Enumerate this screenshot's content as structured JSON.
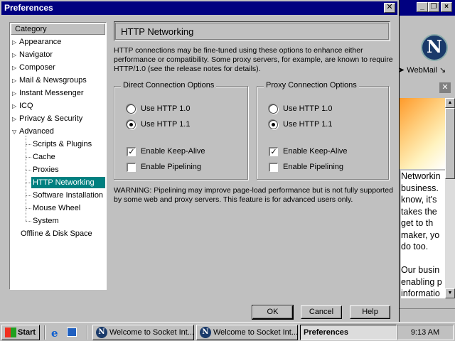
{
  "dialog": {
    "title": "Preferences",
    "close_glyph": "✕"
  },
  "tree": {
    "header": "Category",
    "items": [
      {
        "label": "Appearance",
        "expand": "▷"
      },
      {
        "label": "Navigator",
        "expand": "▷"
      },
      {
        "label": "Composer",
        "expand": "▷"
      },
      {
        "label": "Mail & Newsgroups",
        "expand": "▷"
      },
      {
        "label": "Instant Messenger",
        "expand": "▷"
      },
      {
        "label": "ICQ",
        "expand": "▷"
      },
      {
        "label": "Privacy & Security",
        "expand": "▷"
      },
      {
        "label": "Advanced",
        "expand": "▽"
      },
      {
        "label": "Scripts & Plugins"
      },
      {
        "label": "Cache"
      },
      {
        "label": "Proxies"
      },
      {
        "label": "HTTP Networking"
      },
      {
        "label": "Software Installation"
      },
      {
        "label": "Mouse Wheel"
      },
      {
        "label": "System"
      },
      {
        "label": "Offline & Disk Space"
      }
    ]
  },
  "panel": {
    "title": "HTTP Networking",
    "description": "HTTP connections may be fine-tuned using these options to enhance either performance or compatibility. Some proxy servers, for example, are known to require HTTP/1.0 (see the release notes for details).",
    "direct": {
      "label": "Direct Connection Options",
      "http10": "Use HTTP 1.0",
      "http11": "Use HTTP 1.1",
      "keepalive": "Enable Keep-Alive",
      "pipelining": "Enable Pipelining"
    },
    "proxy": {
      "label": "Proxy Connection Options",
      "http10": "Use HTTP 1.0",
      "http11": "Use HTTP 1.1",
      "keepalive": "Enable Keep-Alive",
      "pipelining": "Enable Pipelining"
    },
    "warning": "WARNING: Pipelining may improve page-load performance but is not fully supported by some web and proxy servers. This feature is for advanced users only."
  },
  "buttons": {
    "ok": "OK",
    "cancel": "Cancel",
    "help": "Help"
  },
  "background_window": {
    "webmail": "WebMail",
    "logo": "N",
    "text_lines": [
      "Networkin",
      "business.",
      "know, it's",
      "takes the",
      "get to th",
      "maker, yo",
      "do too.",
      "",
      "Our busin",
      "enabling p",
      "informatio"
    ]
  },
  "taskbar": {
    "start": "Start",
    "tasks": [
      "Welcome to Socket Int...",
      "Welcome to Socket Int...",
      "Preferences"
    ],
    "clock": "9:13 AM"
  },
  "colors": {
    "titlebar": "#000080",
    "selection": "#008080",
    "face": "#c0c0c0"
  }
}
